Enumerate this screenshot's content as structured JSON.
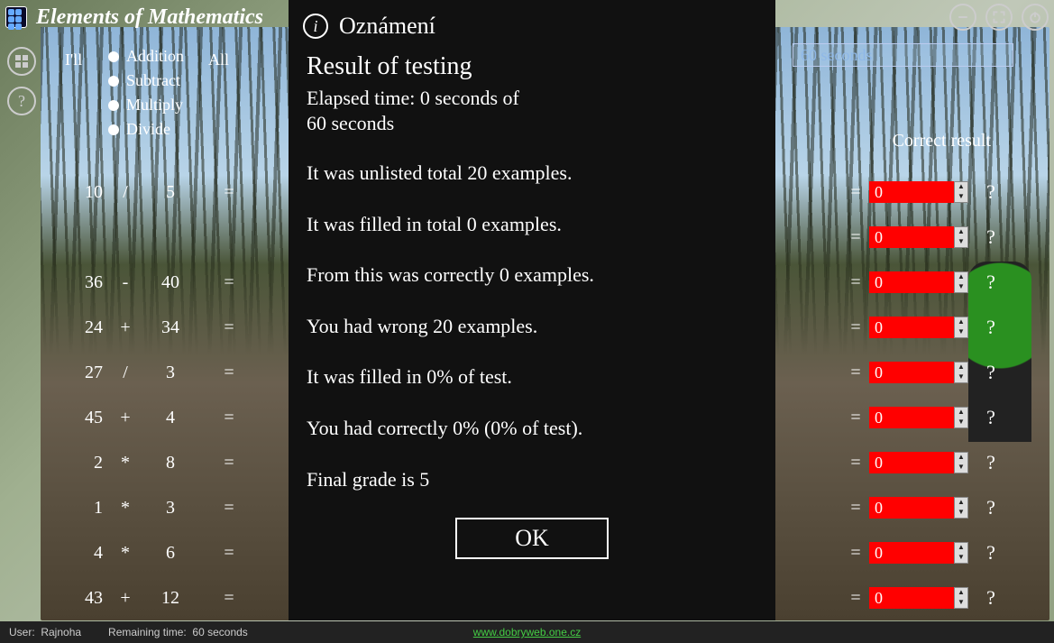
{
  "app": {
    "title": "Elements of Mathematics"
  },
  "window_buttons": {
    "min": "minimize",
    "full": "fullscreen",
    "power": "power"
  },
  "side": {
    "menu": "menu",
    "help": "?"
  },
  "options": {
    "prefix": "I'll",
    "items": [
      "Addition",
      "Subtract",
      "Multiply",
      "Divide"
    ],
    "all": "All"
  },
  "timer": {
    "text": "60 seconds"
  },
  "header": {
    "correct": "Correct result"
  },
  "rows": [
    {
      "a": "10",
      "op": "/",
      "b": "5",
      "eq": "=",
      "ans": "0"
    },
    {
      "a": "",
      "op": "",
      "b": "",
      "eq": "",
      "ans": "0"
    },
    {
      "a": "36",
      "op": "-",
      "b": "40",
      "eq": "=",
      "ans": "0"
    },
    {
      "a": "24",
      "op": "+",
      "b": "34",
      "eq": "=",
      "ans": "0"
    },
    {
      "a": "27",
      "op": "/",
      "b": "3",
      "eq": "=",
      "ans": "0"
    },
    {
      "a": "45",
      "op": "+",
      "b": "4",
      "eq": "=",
      "ans": "0"
    },
    {
      "a": "2",
      "op": "*",
      "b": "8",
      "eq": "=",
      "ans": "0"
    },
    {
      "a": "1",
      "op": "*",
      "b": "3",
      "eq": "=",
      "ans": "0"
    },
    {
      "a": "4",
      "op": "*",
      "b": "6",
      "eq": "=",
      "ans": "0"
    },
    {
      "a": "43",
      "op": "+",
      "b": "12",
      "eq": "=",
      "ans": "0"
    }
  ],
  "qmark": "?",
  "status": {
    "user_label": "User:",
    "user": "Rajnoha",
    "remain_label": "Remaining time:",
    "remain": "60 seconds",
    "link": "www.dobryweb.one.cz"
  },
  "modal": {
    "title": "Oznámení",
    "heading": "Result of testing",
    "elapsed_l1": "Elapsed time: 0 seconds of",
    "elapsed_l2": " 60 seconds",
    "line1": "It was unlisted total 20 examples.",
    "line2": "It was filled in total 0 examples.",
    "line3": "From this was correctly 0 examples.",
    "line4": "You had wrong 20 examples.",
    "line5": "It was filled in 0% of test.",
    "line6": "You had correctly 0% (0% of test).",
    "line7": "Final grade is 5",
    "ok": "OK"
  }
}
